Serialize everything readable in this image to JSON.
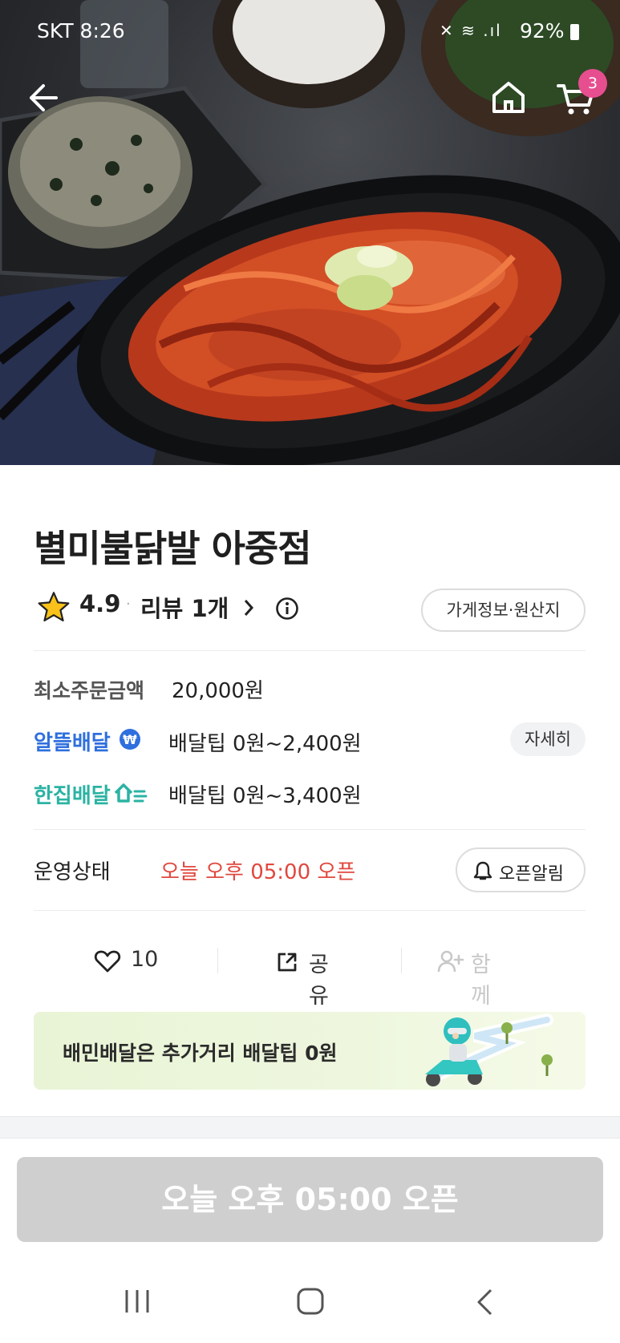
{
  "status_bar": {
    "carrier_time": "SKT 8:26",
    "battery": "92%"
  },
  "header": {
    "cart_count": "3"
  },
  "store": {
    "name": "별미불닭발 아중점",
    "rating": "4.9",
    "reviews_label": "리뷰 1개",
    "info_button": "가게정보·원산지"
  },
  "details": {
    "min_order_label": "최소주문금액",
    "min_order_value": "20,000원",
    "delivery_types": [
      {
        "name": "알뜰배달",
        "fee": "배달팁 0원~2,400원",
        "color": "#2f6fde",
        "action": "자세히"
      },
      {
        "name": "한집배달",
        "fee": "배달팁 0원~3,400원",
        "color": "#2bb3a3"
      }
    ],
    "status_label": "운영상태",
    "status_value": "오늘 오후 05:00 오픈",
    "status_color": "#e0483e",
    "alarm_button": "오픈알림"
  },
  "actions": {
    "likes": "10",
    "share": "공유",
    "group_order": "함께주문"
  },
  "banner": {
    "text": "배민배달은 추가거리 배달팁 0원"
  },
  "cta": {
    "label": "오늘 오후 05:00 오픈"
  }
}
